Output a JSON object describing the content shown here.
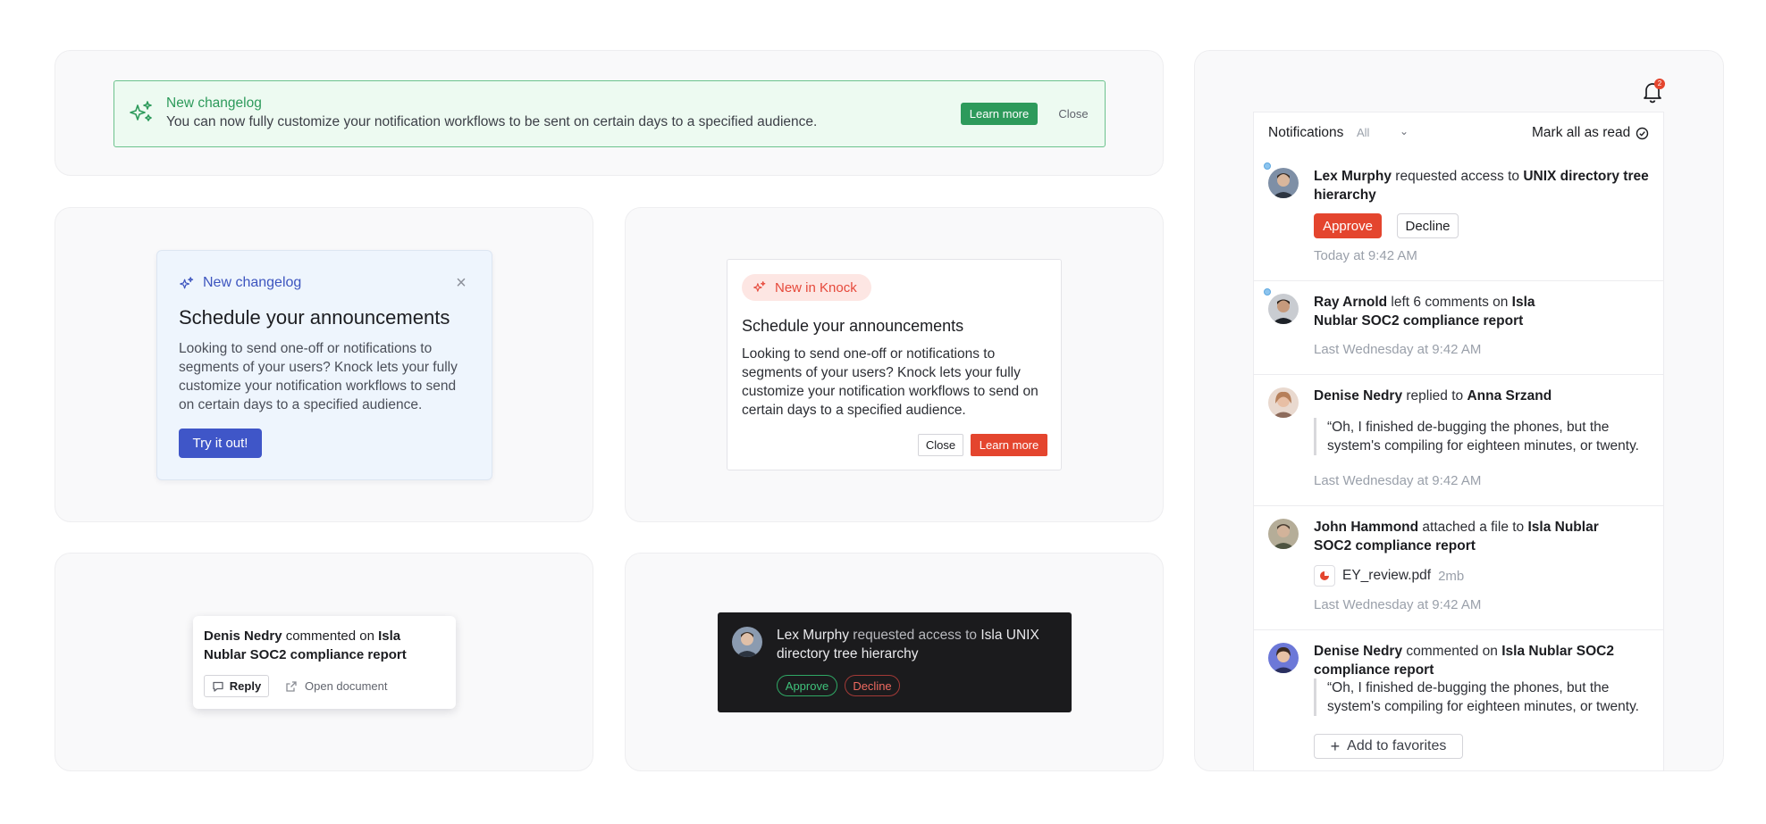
{
  "banner": {
    "title": "New changelog",
    "body": "You can now fully customize your notification workflows to be sent on certain days to a specified audience.",
    "learn_more": "Learn more",
    "close": "Close",
    "icon": "sparkles-icon"
  },
  "blue_card": {
    "header": "New changelog",
    "close_glyph": "×",
    "title": "Schedule your announcements",
    "body": "Looking to send one-off or notifications to segments of your users? Knock lets your fully customize your notification workflows to send on certain days to a specified audience.",
    "cta": "Try it out!"
  },
  "knock_card": {
    "pill": "New in Knock",
    "title": "Schedule your announcements",
    "body": "Looking to send one-off or notifications to segments of your users? Knock lets your fully customize your notification workflows to send on certain days to a specified audience.",
    "close": "Close",
    "learn_more": "Learn more"
  },
  "comment_card": {
    "actor": "Denis Nedry",
    "verb": " commented on ",
    "target": "Isla Nublar SOC2 compliance report",
    "reply": "Reply",
    "open": "Open document"
  },
  "dark_toast": {
    "actor": "Lex Murphy",
    "verb": " requested access to ",
    "target": "Isla UNIX directory tree hierarchy",
    "approve": "Approve",
    "decline": "Decline"
  },
  "feed": {
    "bell_count": "2",
    "title": "Notifications",
    "filter": "All",
    "mark_all": "Mark all as read",
    "items": [
      {
        "actor": "Lex Murphy",
        "verb": " requested access to ",
        "target": "UNIX directory tree hierarchy",
        "approve": "Approve",
        "decline": "Decline",
        "time": "Today at 9:42 AM"
      },
      {
        "actor": "Ray Arnold",
        "verb": " left 6 comments on ",
        "target": "Isla Nublar SOC2 compliance report",
        "time": "Last Wednesday at 9:42 AM"
      },
      {
        "actor": "Denise Nedry",
        "verb": " replied to ",
        "target": "Anna Srzand",
        "quote_line1": "“Oh, I finished de-bugging the phones, but the",
        "quote_line2": "system's compiling for eighteen minutes, or twenty.",
        "time": "Last Wednesday at 9:42 AM"
      },
      {
        "actor": "John Hammond",
        "verb": " attached a file to ",
        "target": "Isla Nublar SOC2 compliance report",
        "file_name": "EY_review.pdf",
        "file_size": "2mb",
        "time": "Last Wednesday at 9:42 AM"
      },
      {
        "actor": "Denise Nedry",
        "verb": " commented on ",
        "target": "Isla Nublar SOC2 compliance report",
        "quote_line1": "“Oh, I finished de-bugging the phones, but the",
        "quote_line2": "system's compiling for eighteen minutes, or twenty.",
        "favorites": "Add to favorites"
      }
    ]
  },
  "colors": {
    "green": "#2d9a5b",
    "blue": "#3f56c8",
    "red": "#e4452e",
    "dark": "#1b1b1d"
  }
}
